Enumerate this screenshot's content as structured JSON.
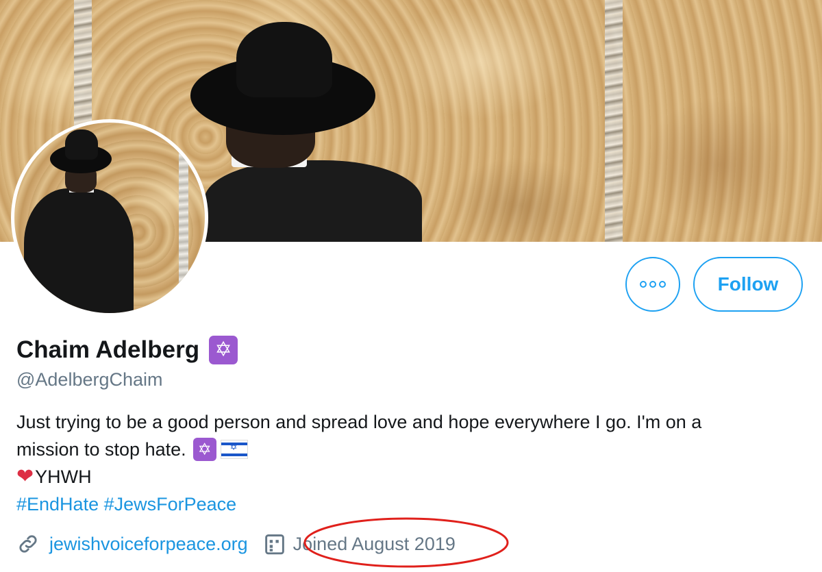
{
  "profile": {
    "display_name": "Chaim Adelberg",
    "name_emoji": "✡",
    "handle": "@AdelbergChaim",
    "bio": {
      "line1": "Just trying to be a good person and spread love and hope everywhere I go.  I'm on a",
      "line2": "mission to stop hate.",
      "line2_emoji": "✡",
      "line3_heart": "❤",
      "line3_text": "YHWH",
      "hashtags": "#EndHate #JewsForPeace"
    },
    "website": "jewishvoiceforpeace.org",
    "joined": "Joined August 2019"
  },
  "actions": {
    "follow_label": "Follow"
  },
  "icons": {
    "more": "more-options-icon",
    "link": "link-icon",
    "calendar": "calendar-icon"
  },
  "colors": {
    "accent": "#1da1f2",
    "link": "#1b95e0",
    "secondary_text": "#657786",
    "emoji_bg": "#9b59d0",
    "annotation": "#e0201b"
  }
}
